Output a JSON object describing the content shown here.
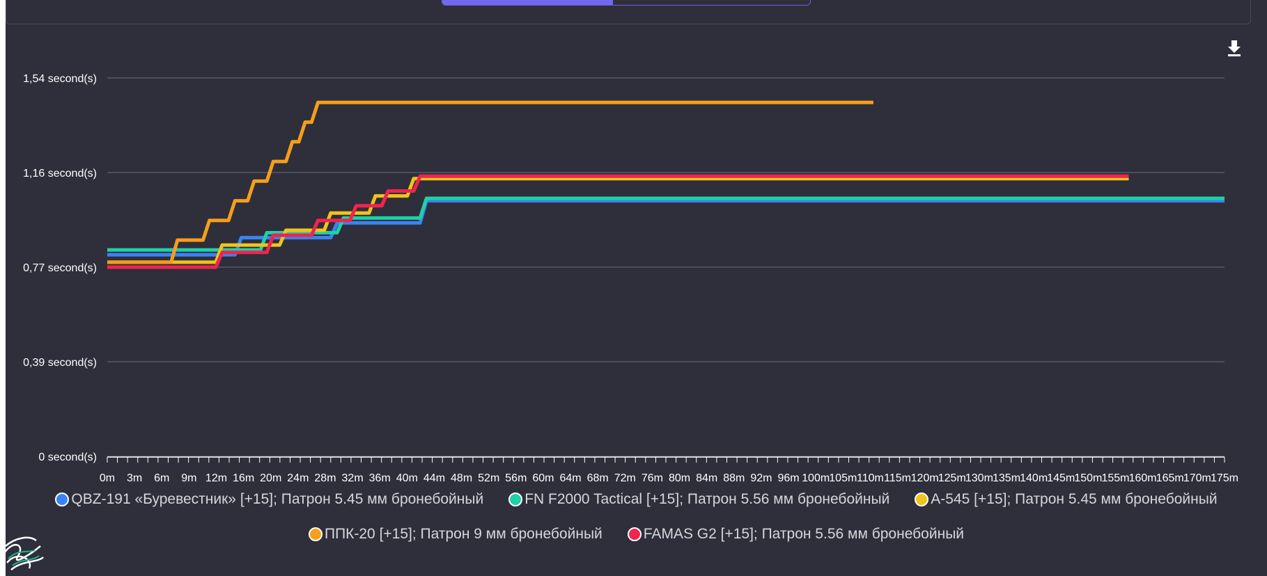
{
  "download_icon": "download-icon",
  "chart_data": {
    "type": "line",
    "title": "",
    "xlabel": "",
    "ylabel": "",
    "x_tick_labels": [
      "0m",
      "3m",
      "6m",
      "9m",
      "12m",
      "16m",
      "20m",
      "24m",
      "28m",
      "32m",
      "36m",
      "40m",
      "44m",
      "48m",
      "52m",
      "56m",
      "60m",
      "64m",
      "68m",
      "72m",
      "76m",
      "80m",
      "84m",
      "88m",
      "92m",
      "96m",
      "100m",
      "105m",
      "110m",
      "115m",
      "120m",
      "125m",
      "130m",
      "135m",
      "140m",
      "145m",
      "150m",
      "155m",
      "160m",
      "165m",
      "170m",
      "175m"
    ],
    "y_ticks": [
      {
        "value": 0,
        "label": "0 second(s)"
      },
      {
        "value": 0.385,
        "label": "0,39 second(s)"
      },
      {
        "value": 0.77,
        "label": "0,77 second(s)"
      },
      {
        "value": 1.155,
        "label": "1,16 second(s)"
      },
      {
        "value": 1.54,
        "label": "1,54 second(s)"
      }
    ],
    "ylim": [
      0,
      1.54
    ],
    "xlim": [
      0,
      175
    ],
    "grid": true,
    "legend_position": "bottom",
    "series": [
      {
        "name": "QBZ-191 «Буревестник» [+15]; Патрон 5.45 мм бронебойный",
        "color": "#3b82f6",
        "points": [
          [
            0,
            0.82
          ],
          [
            20,
            0.82
          ],
          [
            21,
            0.89
          ],
          [
            35,
            0.89
          ],
          [
            36,
            0.95
          ],
          [
            49,
            0.95
          ],
          [
            50,
            1.04
          ],
          [
            175,
            1.04
          ]
        ]
      },
      {
        "name": "FN F2000 Tactical [+15]; Патрон 5.56 мм бронебойный",
        "color": "#1fd1a5",
        "points": [
          [
            0,
            0.84
          ],
          [
            24,
            0.84
          ],
          [
            25,
            0.91
          ],
          [
            36,
            0.91
          ],
          [
            37,
            0.97
          ],
          [
            49,
            0.97
          ],
          [
            50,
            1.05
          ],
          [
            175,
            1.05
          ]
        ]
      },
      {
        "name": "A-545 [+15]; Патрон 5.45 мм бронебойный",
        "color": "#f0c419",
        "points": [
          [
            0,
            0.79
          ],
          [
            17,
            0.79
          ],
          [
            18,
            0.86
          ],
          [
            27,
            0.86
          ],
          [
            28,
            0.92
          ],
          [
            34,
            0.92
          ],
          [
            35,
            0.99
          ],
          [
            41,
            0.99
          ],
          [
            42,
            1.06
          ],
          [
            47,
            1.06
          ],
          [
            48,
            1.13
          ],
          [
            160,
            1.13
          ]
        ]
      },
      {
        "name": "ППК-20 [+15]; Патрон 9 мм бронебойный",
        "color": "#f59f1a",
        "points": [
          [
            0,
            0.79
          ],
          [
            10,
            0.79
          ],
          [
            11,
            0.88
          ],
          [
            15,
            0.88
          ],
          [
            16,
            0.96
          ],
          [
            19,
            0.96
          ],
          [
            20,
            1.04
          ],
          [
            22,
            1.04
          ],
          [
            23,
            1.12
          ],
          [
            25,
            1.12
          ],
          [
            26,
            1.2
          ],
          [
            28,
            1.2
          ],
          [
            29,
            1.28
          ],
          [
            30,
            1.28
          ],
          [
            31,
            1.36
          ],
          [
            32,
            1.36
          ],
          [
            33,
            1.44
          ],
          [
            120,
            1.44
          ]
        ]
      },
      {
        "name": "FAMAS G2 [+15]; Патрон 5.56 мм бронебойный",
        "color": "#f0244e",
        "points": [
          [
            0,
            0.77
          ],
          [
            17,
            0.77
          ],
          [
            18,
            0.83
          ],
          [
            25,
            0.83
          ],
          [
            26,
            0.9
          ],
          [
            32,
            0.9
          ],
          [
            33,
            0.96
          ],
          [
            38,
            0.96
          ],
          [
            39,
            1.02
          ],
          [
            43,
            1.02
          ],
          [
            44,
            1.08
          ],
          [
            48,
            1.08
          ],
          [
            49,
            1.14
          ],
          [
            160,
            1.14
          ]
        ]
      }
    ]
  }
}
